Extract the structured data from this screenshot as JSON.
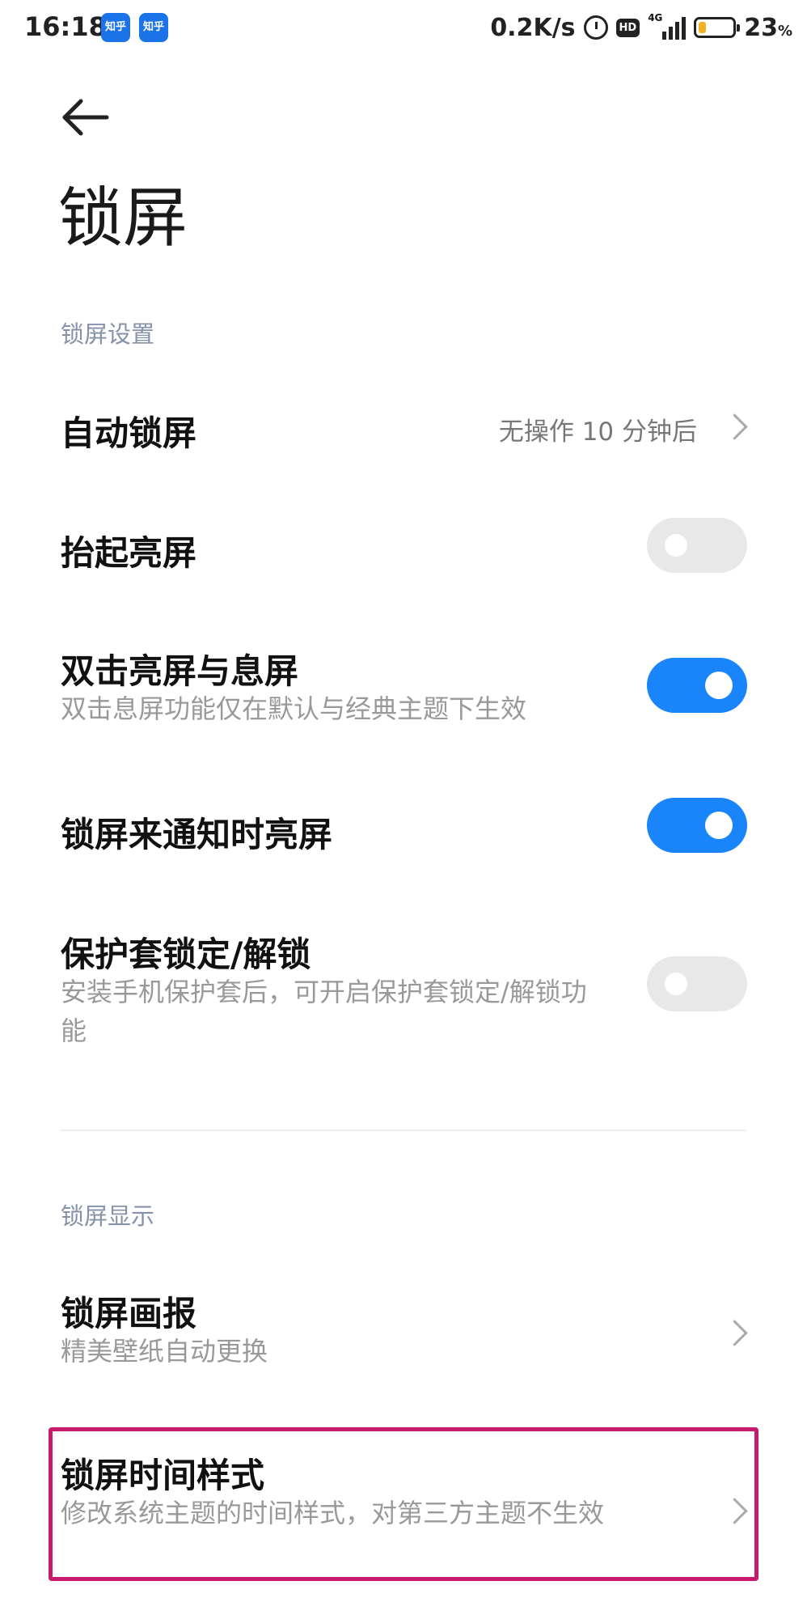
{
  "status_bar": {
    "time": "16:18",
    "app_badges": [
      "知乎",
      "知乎"
    ],
    "net_speed": "0.2K/s",
    "hd_label": "HD",
    "network_label": "4G",
    "battery_percent": "23",
    "battery_unit": "%",
    "battery_level": 0.23
  },
  "header": {
    "title": "锁屏"
  },
  "sections": {
    "lock_settings": "锁屏设置",
    "lock_display": "锁屏显示"
  },
  "items": {
    "auto_lock": {
      "title": "自动锁屏",
      "value": "无操作 10 分钟后"
    },
    "raise_to_wake": {
      "title": "抬起亮屏",
      "enabled": false
    },
    "double_tap": {
      "title": "双击亮屏与息屏",
      "subtitle": "双击息屏功能仅在默认与经典主题下生效",
      "enabled": true
    },
    "notify_wake": {
      "title": "锁屏来通知时亮屏",
      "enabled": true
    },
    "cover_lock": {
      "title": "保护套锁定/解锁",
      "subtitle": "安装手机保护套后，可开启保护套锁定/解锁功能",
      "enabled": false
    },
    "wallpaper_carousel": {
      "title": "锁屏画报",
      "subtitle": "精美壁纸自动更换"
    },
    "clock_style": {
      "title": "锁屏时间样式",
      "subtitle": "修改系统主题的时间样式，对第三方主题不生效"
    }
  },
  "colors": {
    "accent": "#1a84fb",
    "section_label": "#8592a8",
    "highlight": "#c61a6e"
  }
}
